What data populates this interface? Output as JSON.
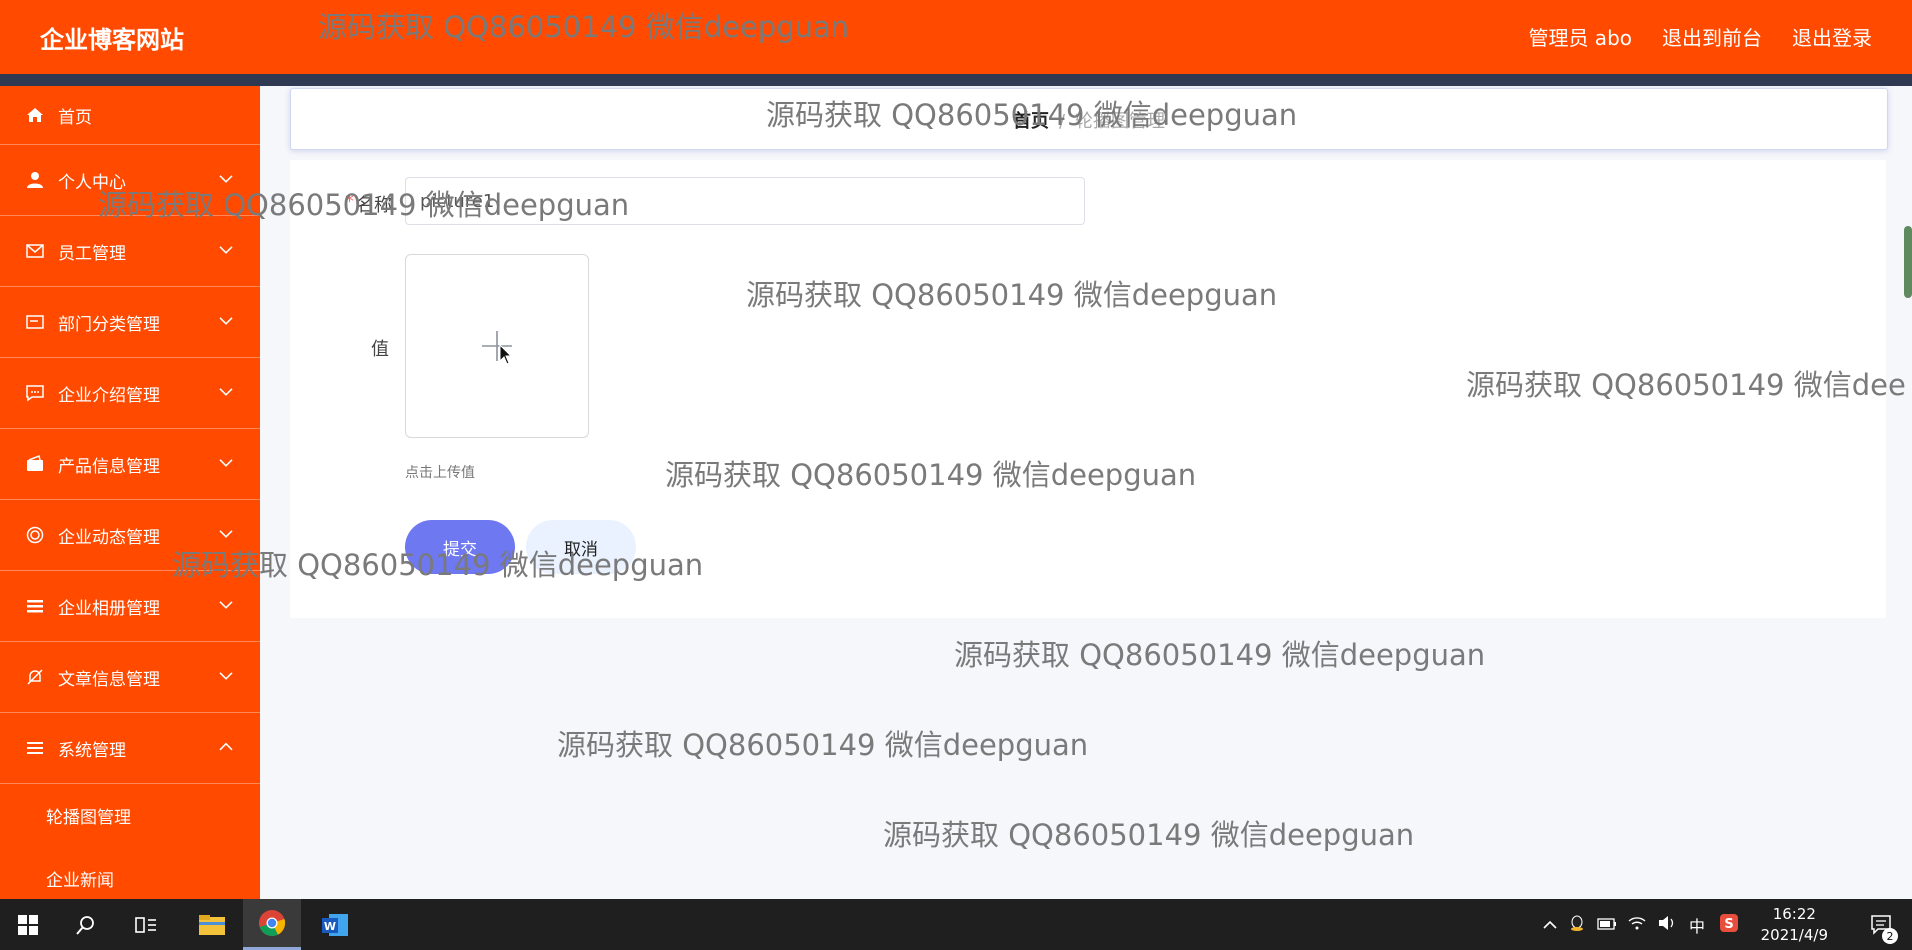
{
  "header": {
    "brand": "企业博客网站",
    "admin_label": "管理员 abo",
    "to_frontend": "退出到前台",
    "logout": "退出登录"
  },
  "sidebar": {
    "items": [
      {
        "label": "首页",
        "icon": "home-icon"
      },
      {
        "label": "个人中心",
        "icon": "user-icon"
      },
      {
        "label": "员工管理",
        "icon": "mail-icon"
      },
      {
        "label": "部门分类管理",
        "icon": "card-icon"
      },
      {
        "label": "企业介绍管理",
        "icon": "chat-icon"
      },
      {
        "label": "产品信息管理",
        "icon": "wallet-icon"
      },
      {
        "label": "企业动态管理",
        "icon": "target-icon"
      },
      {
        "label": "企业相册管理",
        "icon": "list-icon"
      },
      {
        "label": "文章信息管理",
        "icon": "bell-off-icon"
      },
      {
        "label": "系统管理",
        "icon": "menu-icon"
      }
    ],
    "sub_items": [
      {
        "label": "轮播图管理"
      },
      {
        "label": "企业新闻"
      }
    ]
  },
  "breadcrumb": {
    "home": "首页",
    "separator": "/",
    "current": "轮播图管理"
  },
  "form": {
    "name_label": "名称",
    "name_value": "picture1",
    "value_label": "值",
    "upload_tip": "点击上传值",
    "submit": "提交",
    "cancel": "取消"
  },
  "watermarks": {
    "text": "源码获取 QQ86050149 微信deepguan",
    "text_cut": "源码获取 QQ86050149 微信dee"
  },
  "taskbar": {
    "time": "16:22",
    "date": "2021/4/9",
    "ime": "中",
    "notification_count": "2"
  },
  "colors": {
    "brand": "#ff4a00",
    "header_strip": "#2f3a52",
    "submit": "#6e78f0",
    "cancel": "#eaf1ff"
  }
}
